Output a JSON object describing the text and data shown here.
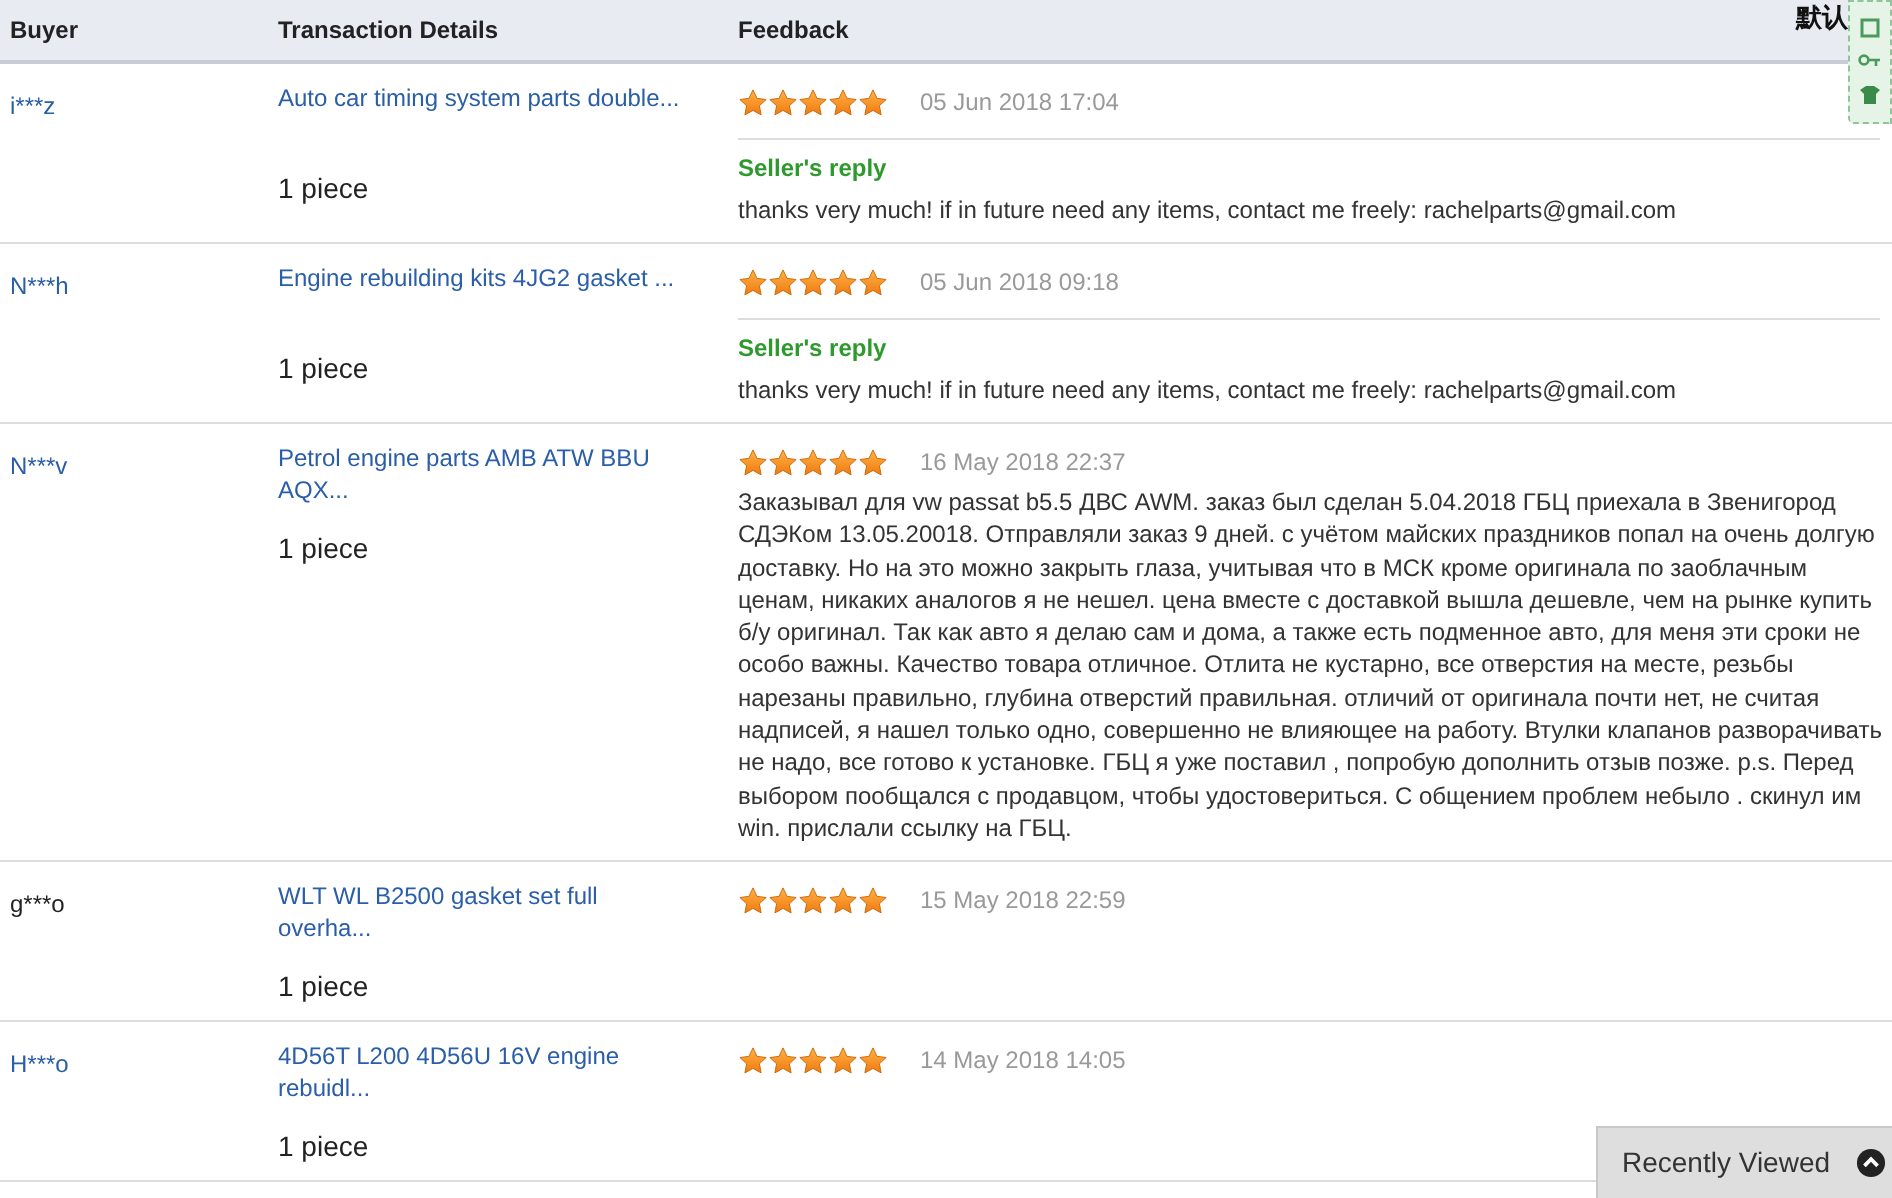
{
  "header": {
    "columns": [
      "Buyer",
      "Transaction Details",
      "Feedback"
    ],
    "overlay_text": "默认"
  },
  "rows": [
    {
      "buyer": "i***z",
      "color": "#2a5ea8",
      "product": "Auto car timing system parts double...",
      "quantity": "1 piece",
      "stars": 5,
      "date": "05 Jun 2018 17:04",
      "review": null,
      "reply": {
        "label": "Seller's reply",
        "text": "thanks very much! if in future need any items, contact me freely: rachelparts@gmail.com"
      }
    },
    {
      "buyer": "N***h",
      "color": "#2a5ea8",
      "product": "Engine rebuilding kits 4JG2 gasket ...",
      "quantity": "1 piece",
      "stars": 5,
      "date": "05 Jun 2018 09:18",
      "review": null,
      "reply": {
        "label": "Seller's reply",
        "text": "thanks very much! if in future need any items, contact me freely: rachelparts@gmail.com"
      }
    },
    {
      "buyer": "N***v",
      "color": "#2a5ea8",
      "product": "Petrol engine parts AMB ATW BBU AQX...",
      "quantity": "1 piece",
      "stars": 5,
      "date": "16 May 2018 22:37",
      "review": "Заказывал для vw passat b5.5 ДВС AWM. заказ был сделан 5.04.2018 ГБЦ приехала в Звенигород СДЭКом 13.05.20018. Отправляли заказ 9 дней. с учётом майских праздников попал на очень долгую доставку. Но на это можно закрыть глаза, учитывая что в МСК кроме оригинала по заоблачным ценам, никаких аналогов я не нешел. цена вместе с доставкой вышла дешевле, чем на рынке купить б/у оригинал. Так как авто я делаю сам и дома, а также есть подменное авто, для меня эти сроки не особо важны. Качество товара отличное. Отлита не кустарно, все отверстия на месте, резьбы нарезаны правильно, глубина отверстий правильная. отличий от оригинала почти нет, не считая надписей, я нашел только одно, совершенно не влияющее на работу. Втулки клапанов разворачивать не надо, все готово к установке. ГБЦ я уже поставил , попробую дополнить отзыв позже. p.s. Перед выбором пообщался с продавцом, чтобы удостовериться. С общением проблем небыло . скинул им win. прислали ссылку на ГБЦ.",
      "reply": null
    },
    {
      "buyer": "g***o",
      "color": "#222222",
      "product": "WLT WL B2500 gasket set full overha...",
      "quantity": "1 piece",
      "stars": 5,
      "date": "15 May 2018 22:59",
      "review": null,
      "reply": null
    },
    {
      "buyer": "H***o",
      "color": "#2a5ea8",
      "product": "4D56T L200 4D56U 16V engine rebuidl...",
      "quantity": "1 piece",
      "stars": 5,
      "date": "14 May 2018 14:05",
      "review": null,
      "reply": null
    }
  ],
  "recently_viewed": {
    "label": "Recently Viewed"
  }
}
